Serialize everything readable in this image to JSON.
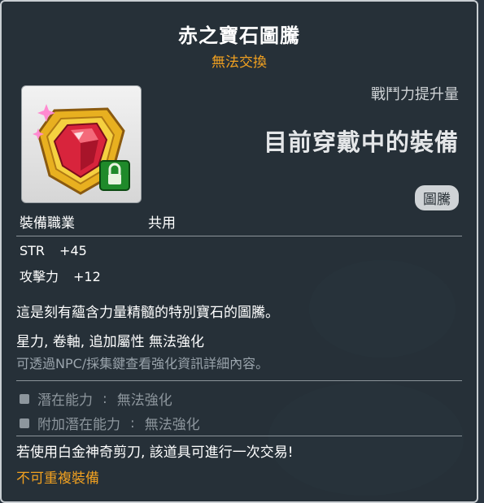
{
  "item": {
    "name": "赤之寶石圖騰",
    "trade": "無法交換",
    "power_label": "戰鬥力提升量",
    "equip_status": "目前穿戴中的裝備",
    "category": "圖騰",
    "job_label": "裝備職業",
    "job_value": "共用"
  },
  "stats": [
    {
      "name": "STR",
      "value": "+45"
    },
    {
      "name": "攻擊力",
      "value": "+12"
    }
  ],
  "description": "這是刻有蘊含力量精髓的特別寶石的圖騰。",
  "enhance": {
    "notice": "星力, 卷軸, 追加屬性 無法強化",
    "hint": "可透過NPC/採集鍵查看強化資訊詳細內容。"
  },
  "potentials": [
    {
      "label": "潛在能力",
      "colon": ":",
      "value": "無法強化"
    },
    {
      "label": "附加潛在能力",
      "colon": ":",
      "value": "無法強化"
    }
  ],
  "scissor_text": "若使用白金神奇剪刀, 該道具可進行一次交易!",
  "unique_text": "不可重複裝備"
}
